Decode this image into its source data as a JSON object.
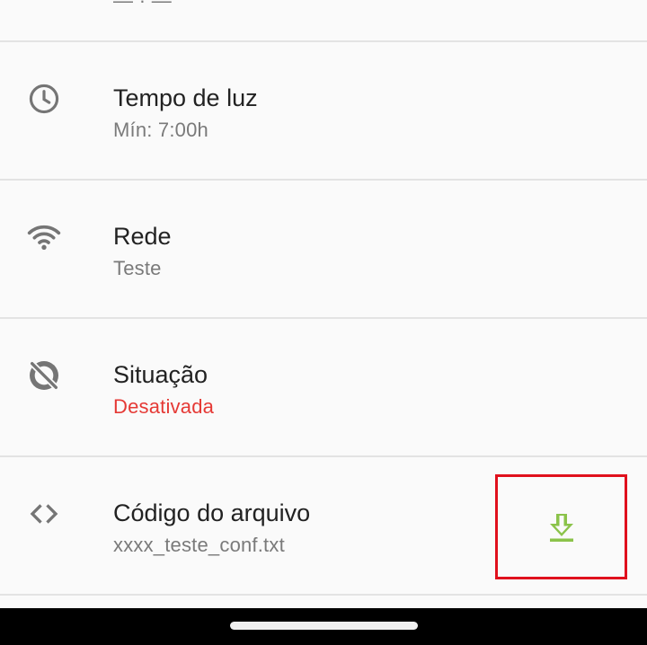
{
  "top_partial": {
    "sub": "— · —"
  },
  "rows": [
    {
      "title": "Tempo de luz",
      "sub": "Mín: 7:00h",
      "icon": "clock-icon"
    },
    {
      "title": "Rede",
      "sub": "Teste",
      "icon": "wifi-icon"
    },
    {
      "title": "Situação",
      "sub": "Desativada",
      "icon": "sync-disabled-icon"
    },
    {
      "title": "Código do arquivo",
      "sub": "xxxx_teste_conf.txt",
      "icon": "code-icon"
    }
  ],
  "colors": {
    "title": "#222222",
    "subtitle": "#7a7a7a",
    "icon": "#757575",
    "alert": "#e53935",
    "download": "#8bc34a",
    "highlight_box": "#e0101d",
    "divider": "#e3e3e3"
  },
  "download_button": {
    "icon": "download-icon"
  }
}
